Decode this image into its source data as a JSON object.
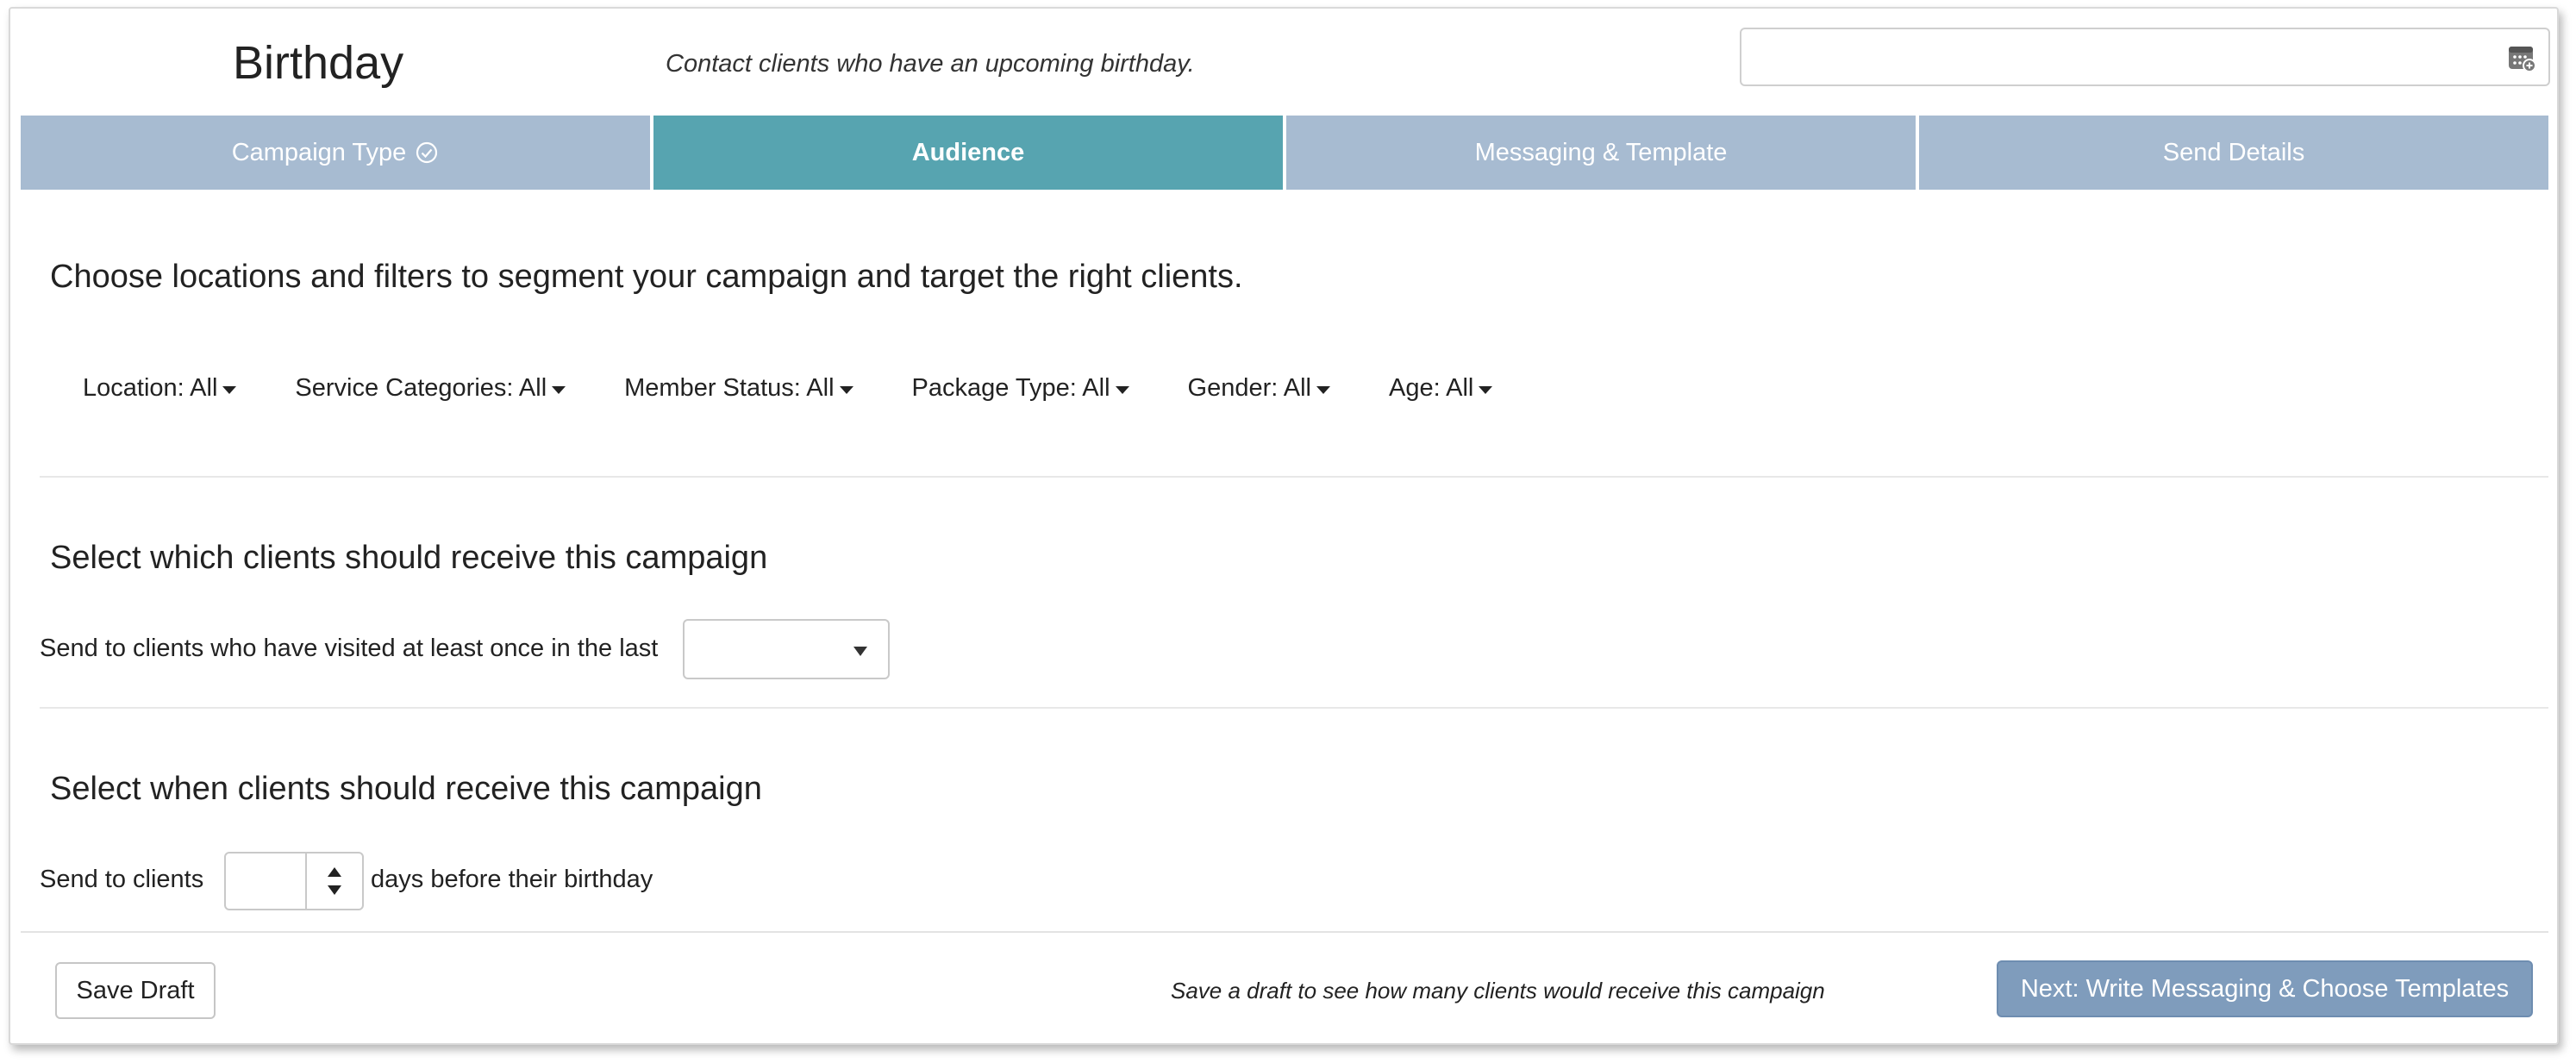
{
  "header": {
    "title": "Birthday",
    "description": "Contact clients who have an upcoming birthday.",
    "date_field": {
      "value": "",
      "icon": "calendar-icon"
    }
  },
  "tabs": [
    {
      "label": "Campaign Type",
      "state": "complete",
      "icon": "check-circle-icon"
    },
    {
      "label": "Audience",
      "state": "active"
    },
    {
      "label": "Messaging & Template",
      "state": "upcoming"
    },
    {
      "label": "Send Details",
      "state": "upcoming"
    }
  ],
  "audience": {
    "intro": "Choose locations and filters to segment your campaign and target the right clients.",
    "filters": [
      {
        "label": "Location: All"
      },
      {
        "label": "Service Categories: All"
      },
      {
        "label": "Member Status: All"
      },
      {
        "label": "Package Type: All"
      },
      {
        "label": "Gender: All"
      },
      {
        "label": "Age: All"
      }
    ]
  },
  "recipients": {
    "heading": "Select which clients should receive this campaign",
    "visited_label": "Send to clients who have visited at least once in the last",
    "visited_value": ""
  },
  "timing": {
    "heading": "Select when clients should receive this campaign",
    "prefix": "Send to clients",
    "days_value": "",
    "suffix": "days before their birthday"
  },
  "footer": {
    "save_draft_label": "Save Draft",
    "note": "Save a draft to see how many clients would receive this campaign",
    "next_label": "Next: Write Messaging & Choose Templates"
  },
  "colors": {
    "tab_inactive": "#a7bbd1",
    "tab_active": "#57a4b0",
    "next_button": "#7f9cbc"
  }
}
